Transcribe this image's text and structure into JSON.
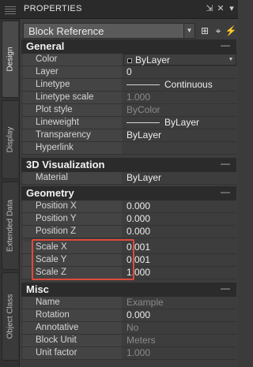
{
  "window": {
    "title": "PROPERTIES"
  },
  "sidebar": {
    "tabs": [
      "Design",
      "Display",
      "Extended Data",
      "Object Class"
    ]
  },
  "selector": {
    "value": "Block Reference"
  },
  "sections": {
    "general": {
      "title": "General",
      "rows": [
        {
          "label": "Color",
          "value": "ByLayer"
        },
        {
          "label": "Layer",
          "value": "0"
        },
        {
          "label": "Linetype",
          "value": "Continuous"
        },
        {
          "label": "Linetype scale",
          "value": "1.000"
        },
        {
          "label": "Plot style",
          "value": "ByColor"
        },
        {
          "label": "Lineweight",
          "value": "ByLayer"
        },
        {
          "label": "Transparency",
          "value": "ByLayer"
        },
        {
          "label": "Hyperlink",
          "value": ""
        }
      ]
    },
    "viz3d": {
      "title": "3D Visualization",
      "rows": [
        {
          "label": "Material",
          "value": "ByLayer"
        }
      ]
    },
    "geometry": {
      "title": "Geometry",
      "rows": [
        {
          "label": "Position X",
          "value": "0.000"
        },
        {
          "label": "Position Y",
          "value": "0.000"
        },
        {
          "label": "Position Z",
          "value": "0.000"
        },
        {
          "label": "Scale X",
          "value": "0.001"
        },
        {
          "label": "Scale Y",
          "value": "0.001"
        },
        {
          "label": "Scale Z",
          "value": "1.000"
        }
      ]
    },
    "misc": {
      "title": "Misc",
      "rows": [
        {
          "label": "Name",
          "value": "Example"
        },
        {
          "label": "Rotation",
          "value": "0.000"
        },
        {
          "label": "Annotative",
          "value": "No"
        },
        {
          "label": "Block Unit",
          "value": "Meters"
        },
        {
          "label": "Unit factor",
          "value": "1.000"
        }
      ]
    }
  },
  "colors": {
    "highlight": "#e04a3c",
    "background": "#3d3d3d",
    "header": "#2b2b2b"
  },
  "icons": [
    "grip-icon",
    "pin-icon",
    "close-icon",
    "properties-menu-icon",
    "quick-select-icon",
    "select-objects-icon",
    "toggle-pickadd-icon",
    "color-swatch-icon"
  ]
}
